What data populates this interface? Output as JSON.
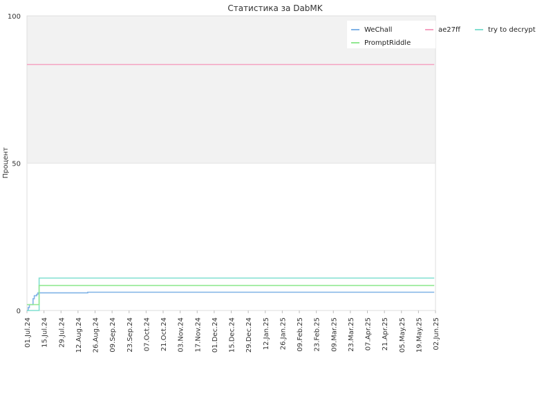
{
  "chart_data": {
    "type": "line",
    "title": "Статистика за DabMK",
    "ylabel": "Процент",
    "xlabel": "",
    "ylim": [
      0,
      100
    ],
    "yticks": [
      0,
      50,
      100
    ],
    "xlim": [
      "2024-07-01",
      "2025-06-02"
    ],
    "xtick_labels": [
      "01.Jul.24",
      "15.Jul.24",
      "29.Jul.24",
      "12.Aug.24",
      "26.Aug.24",
      "09.Sep.24",
      "23.Sep.24",
      "07.Oct.24",
      "21.Oct.24",
      "03.Nov.24",
      "17.Nov.24",
      "01.Dec.24",
      "15.Dec.24",
      "29.Dec.24",
      "12.Jan.25",
      "26.Jan.25",
      "09.Feb.25",
      "23.Feb.25",
      "09.Mar.25",
      "23.Mar.25",
      "07.Apr.25",
      "21.Apr.25",
      "05.May.25",
      "19.May.25",
      "02.Jun.25"
    ],
    "grid": true,
    "shaded_band": [
      50,
      100
    ],
    "legend_position": "top-right",
    "step": true,
    "series": [
      {
        "name": "WeChall",
        "color": "#7fb2e6",
        "points": [
          [
            "2024-07-01",
            0
          ],
          [
            "2024-07-02",
            1
          ],
          [
            "2024-07-03",
            2
          ],
          [
            "2024-07-05",
            2
          ],
          [
            "2024-07-06",
            4
          ],
          [
            "2024-07-07",
            5
          ],
          [
            "2024-07-09",
            5.5
          ],
          [
            "2024-07-10",
            6
          ],
          [
            "2024-08-19",
            6
          ],
          [
            "2024-08-20",
            6.2
          ],
          [
            "2025-06-01",
            6.2
          ]
        ]
      },
      {
        "name": "ae27ff",
        "color": "#f5a0c0",
        "points": [
          [
            "2024-07-01",
            83.5
          ],
          [
            "2025-06-01",
            83.5
          ]
        ]
      },
      {
        "name": "try to decrypt",
        "color": "#80dfd0",
        "points": [
          [
            "2024-07-01",
            0
          ],
          [
            "2024-07-10",
            0
          ],
          [
            "2024-07-11",
            11
          ],
          [
            "2025-06-01",
            11
          ]
        ]
      },
      {
        "name": "PromptRiddle",
        "color": "#90e890",
        "points": [
          [
            "2024-07-01",
            2
          ],
          [
            "2024-07-10",
            2
          ],
          [
            "2024-07-11",
            8.5
          ],
          [
            "2025-06-01",
            8.5
          ]
        ]
      }
    ]
  },
  "legend": {
    "items": [
      {
        "label": "WeChall",
        "color": "#7fb2e6"
      },
      {
        "label": "ae27ff",
        "color": "#f5a0c0"
      },
      {
        "label": "try to decrypt",
        "color": "#80dfd0"
      },
      {
        "label": "PromptRiddle",
        "color": "#90e890"
      }
    ]
  }
}
